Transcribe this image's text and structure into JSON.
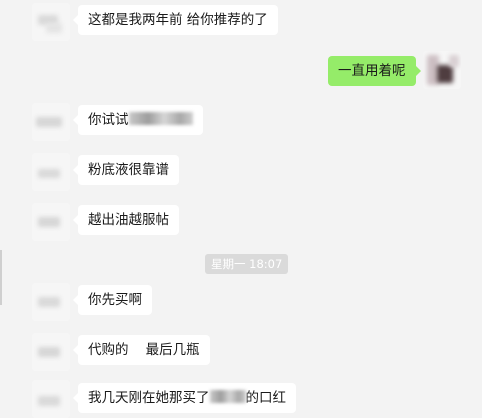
{
  "messages": {
    "m1": "这都是我两年前  给你推荐的了",
    "m2": "一直用着呢",
    "m3_prefix": "你试试",
    "m4": "粉底液很靠谱",
    "m5": "越出油越服帖",
    "m6": "你先买啊",
    "m7": "代购的    最后几瓶",
    "m8_prefix": "我几天刚在她那买了",
    "m8_suffix": "的口红"
  },
  "timestamp": "星期一 18:07",
  "colors": {
    "background": "#f3f3f3",
    "incoming_bubble": "#ffffff",
    "outgoing_bubble": "#95ec69",
    "timestamp_pill": "#dadada"
  },
  "icons": {
    "avatar": "avatar-icon (pixelated/mosaic)",
    "redaction": "mosaic-redaction"
  }
}
